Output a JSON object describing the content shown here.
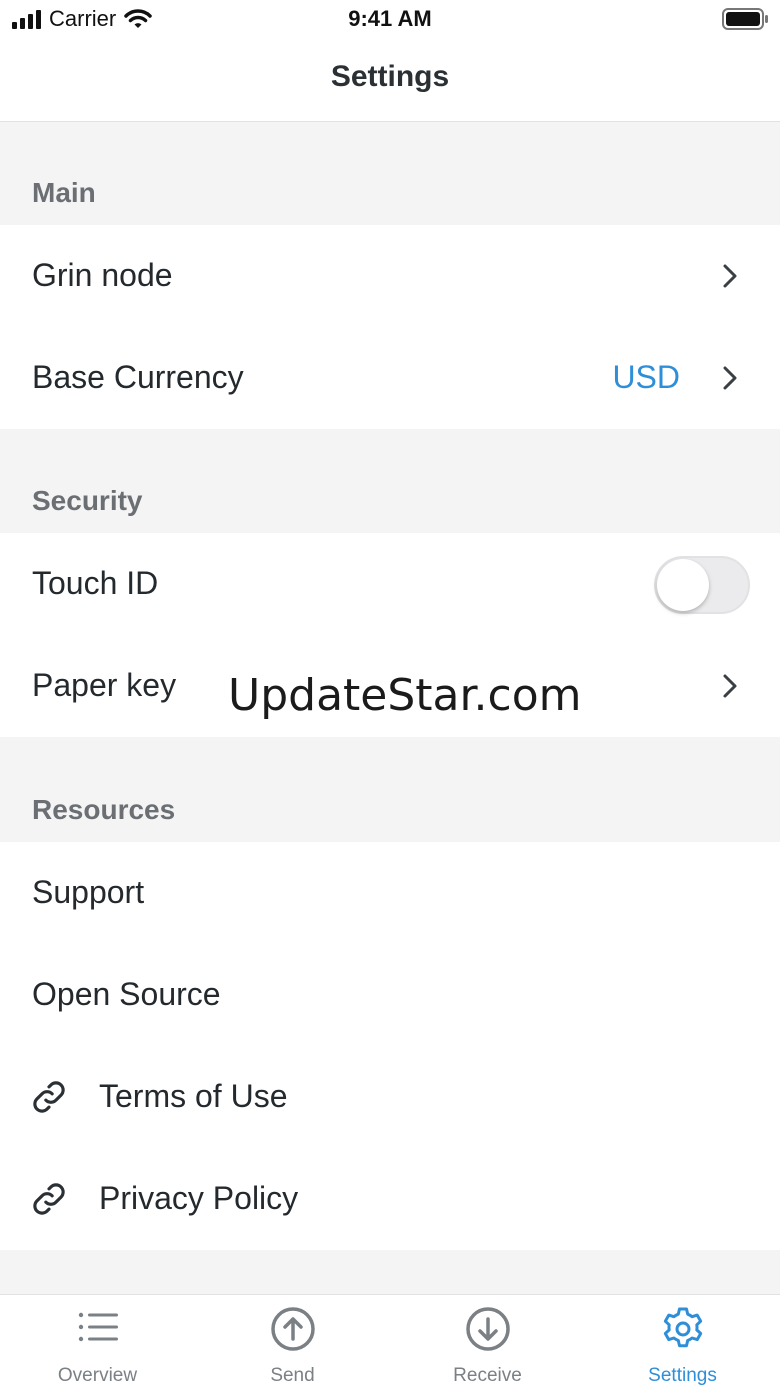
{
  "status": {
    "carrier": "Carrier",
    "time": "9:41 AM"
  },
  "nav": {
    "title": "Settings"
  },
  "sections": {
    "main": {
      "header": "Main",
      "grin_node": "Grin node",
      "base_currency": "Base Currency",
      "base_currency_value": "USD"
    },
    "security": {
      "header": "Security",
      "touch_id": "Touch ID",
      "touch_id_enabled": false,
      "paper_key": "Paper key"
    },
    "resources": {
      "header": "Resources",
      "support": "Support",
      "open_source": "Open Source",
      "terms": "Terms of Use",
      "privacy": "Privacy Policy"
    }
  },
  "watermark": "UpdateStar.com",
  "tabs": [
    {
      "label": "Overview",
      "icon": "list-icon"
    },
    {
      "label": "Send",
      "icon": "arrow-up-circle-icon"
    },
    {
      "label": "Receive",
      "icon": "arrow-down-circle-icon"
    },
    {
      "label": "Settings",
      "icon": "gear-icon"
    }
  ],
  "active_tab": "Settings",
  "colors": {
    "accent": "#2e8fd8",
    "background": "#f4f4f5"
  }
}
